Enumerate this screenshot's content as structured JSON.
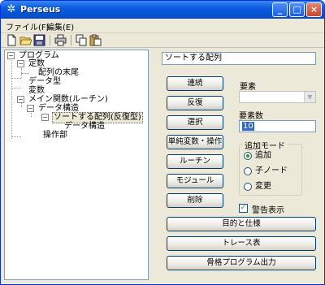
{
  "window": {
    "title": "Perseus",
    "icon": "perseus-app-icon",
    "controls": {
      "minimize": "_",
      "maximize": "□",
      "close": "×"
    }
  },
  "menu": {
    "items": [
      {
        "label": "ファイル(F)"
      },
      {
        "label": "編集(E)"
      }
    ]
  },
  "toolbar": {
    "tools": [
      "new-file-icon",
      "open-folder-icon",
      "save-icon",
      "print-icon",
      "copy-icon",
      "paste-icon"
    ]
  },
  "tree": {
    "nodes": [
      {
        "label": "プログラム",
        "expander": "−"
      },
      {
        "label": "定数",
        "expander": "−"
      },
      {
        "label": "配列の末尾"
      },
      {
        "label": "データ型"
      },
      {
        "label": "変数"
      },
      {
        "label": "メイン関数(ルーチン)",
        "expander": "−"
      },
      {
        "label": "データ構造",
        "expander": "−"
      },
      {
        "label": "ソートする配列(反復型)",
        "expander": "−",
        "selected": true
      },
      {
        "label": "データ構造"
      },
      {
        "label": "操作部"
      }
    ]
  },
  "detail": {
    "name_value": "ソートする配列",
    "buttons": {
      "sequence": "連続",
      "iteration": "反復",
      "selection": "選択",
      "simple_var_op": "単純変数・操作",
      "routine": "ルーチン",
      "module": "モジュール",
      "delete": "削除"
    },
    "element_label": "要素",
    "element_value": "",
    "element_count_label": "要素数",
    "element_count_value": "10",
    "add_mode": {
      "title": "追加モード",
      "options": [
        {
          "label": "追加",
          "selected": true
        },
        {
          "label": "子ノード",
          "selected": false
        },
        {
          "label": "変更",
          "selected": false
        }
      ]
    },
    "warning_display": {
      "label": "警告表示",
      "checked": true
    },
    "wide_buttons": {
      "purpose_spec": "目的と仕様",
      "trace_table": "トレース表",
      "skeleton_output": "骨格プログラム出力"
    }
  },
  "colors": {
    "titlebar": "#0553d6",
    "window_bg": "#ece9d8",
    "selection_highlight": "#316ac5"
  }
}
